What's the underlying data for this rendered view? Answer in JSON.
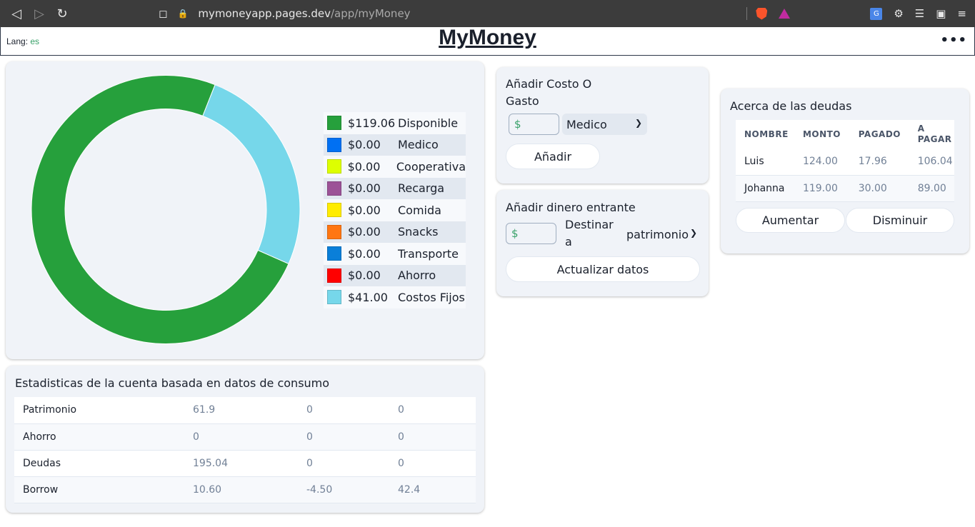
{
  "browser": {
    "url_host": "mymoneyapp.pages.dev",
    "url_path": "/app/myMoney"
  },
  "header": {
    "lang_label": "Lang:",
    "lang_value": "es",
    "title": "MyMoney",
    "menu_label": "•••"
  },
  "legend": [
    {
      "amount": "$119.06",
      "label": "Disponible",
      "color": "#26a03c"
    },
    {
      "amount": "$0.00",
      "label": "Medico",
      "color": "#0070f3"
    },
    {
      "amount": "$0.00",
      "label": "Cooperativa",
      "color": "#ddff00"
    },
    {
      "amount": "$0.00",
      "label": "Recarga",
      "color": "#9c5297"
    },
    {
      "amount": "$0.00",
      "label": "Comida",
      "color": "#ffec00"
    },
    {
      "amount": "$0.00",
      "label": "Snacks",
      "color": "#ff7612"
    },
    {
      "amount": "$0.00",
      "label": "Transporte",
      "color": "#0a7fd9"
    },
    {
      "amount": "$0.00",
      "label": "Ahorro",
      "color": "#ff0000"
    },
    {
      "amount": "$41.00",
      "label": "Costos Fijos",
      "color": "#76d7ea"
    }
  ],
  "chart_data": {
    "type": "pie",
    "categories": [
      "Disponible",
      "Medico",
      "Cooperativa",
      "Recarga",
      "Comida",
      "Snacks",
      "Transporte",
      "Ahorro",
      "Costos Fijos"
    ],
    "values": [
      119.06,
      0,
      0,
      0,
      0,
      0,
      0,
      0,
      41.0
    ],
    "colors": [
      "#26a03c",
      "#0070f3",
      "#ddff00",
      "#9c5297",
      "#ffec00",
      "#ff7612",
      "#0a7fd9",
      "#ff0000",
      "#76d7ea"
    ]
  },
  "stats": {
    "title": "Estadisticas de la cuenta basada en datos de consumo",
    "rows": [
      [
        "Patrimonio",
        "61.9",
        "0",
        "0"
      ],
      [
        "Ahorro",
        "0",
        "0",
        "0"
      ],
      [
        "Deudas",
        "195.04",
        "0",
        "0"
      ],
      [
        "Borrow",
        "10.60",
        "-4.50",
        "42.4"
      ]
    ]
  },
  "add_cost": {
    "title": "Añadir Costo O Gasto",
    "amount_placeholder": "$",
    "category_selected": "Medico",
    "button": "Añadir"
  },
  "add_income": {
    "title": "Añadir dinero entrante",
    "amount_placeholder": "$",
    "dest_label": "Destinar a",
    "dest_selected": "patrimonio",
    "button": "Actualizar datos"
  },
  "debts": {
    "title": "Acerca de las deudas",
    "columns": [
      "NOMBRE",
      "MONTO",
      "PAGADO",
      "A PAGAR"
    ],
    "rows": [
      [
        "Luis",
        "124.00",
        "17.96",
        "106.04"
      ],
      [
        "Johanna",
        "119.00",
        "30.00",
        "89.00"
      ]
    ],
    "increase_button": "Aumentar",
    "decrease_button": "Disminuir"
  }
}
